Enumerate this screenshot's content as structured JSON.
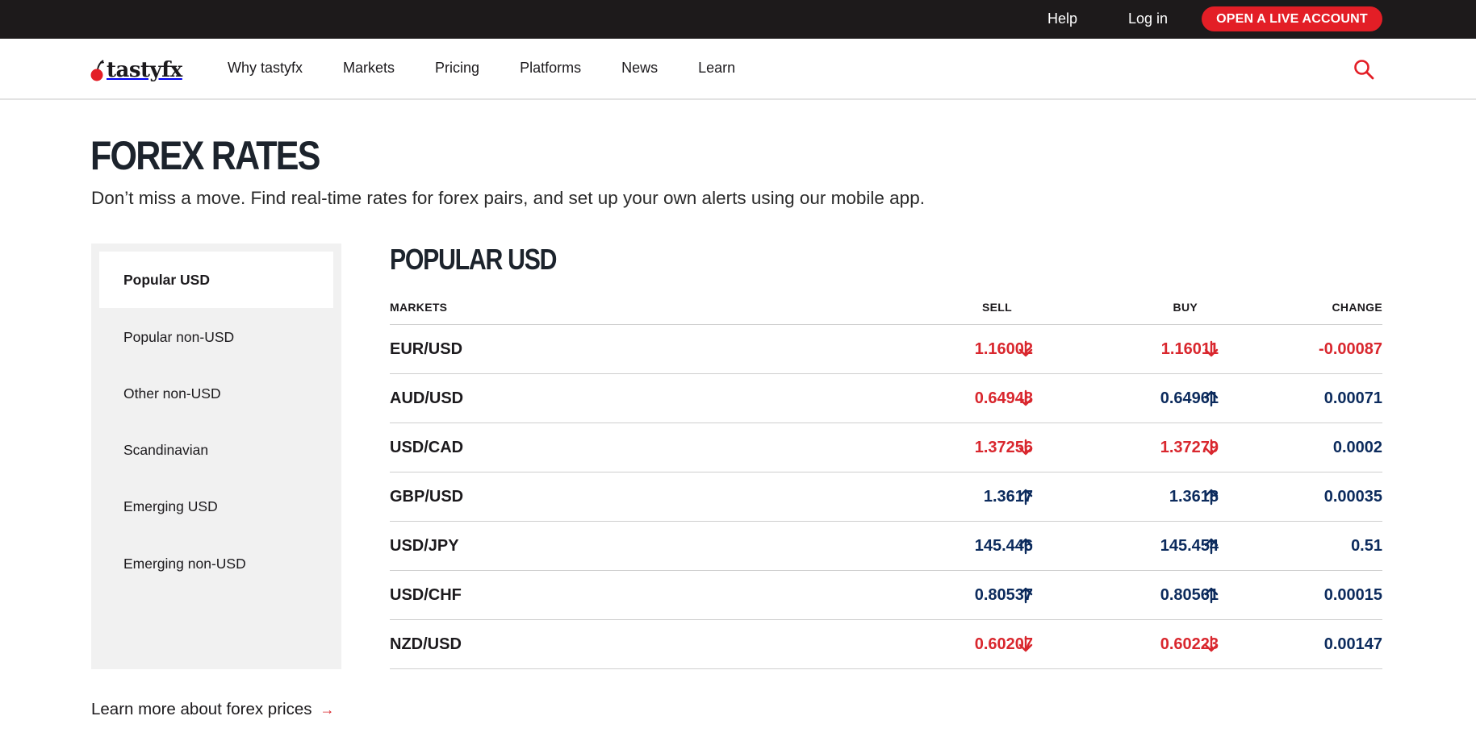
{
  "colors": {
    "accent_red": "#e31e26",
    "down": "#d9272e",
    "up": "#0c2b5d",
    "topbar_bg": "#1d1a1b",
    "sidebar_bg": "#f1f1f1"
  },
  "topbar": {
    "help": "Help",
    "login": "Log in",
    "cta": "OPEN A LIVE ACCOUNT"
  },
  "nav": {
    "logo": "tastyfx",
    "links": [
      "Why tastyfx",
      "Markets",
      "Pricing",
      "Platforms",
      "News",
      "Learn"
    ],
    "search_icon": "search-icon"
  },
  "page": {
    "title": "FOREX RATES",
    "subtitle": "Don’t miss a move. Find real-time rates for forex pairs, and set up your own alerts using our mobile app."
  },
  "sidebar": {
    "items": [
      {
        "label": "Popular USD",
        "active": true
      },
      {
        "label": "Popular non-USD",
        "active": false
      },
      {
        "label": "Other non-USD",
        "active": false
      },
      {
        "label": "Scandinavian",
        "active": false
      },
      {
        "label": "Emerging USD",
        "active": false
      },
      {
        "label": "Emerging non-USD",
        "active": false
      }
    ]
  },
  "table": {
    "title": "POPULAR USD",
    "headers": {
      "market": "MARKETS",
      "sell": "SELL",
      "buy": "BUY",
      "change": "CHANGE"
    },
    "rows": [
      {
        "market": "EUR/USD",
        "sell": "1.16002",
        "sell_dir": "down",
        "buy": "1.16011",
        "buy_dir": "down",
        "change": "-0.00087",
        "change_dir": "down"
      },
      {
        "market": "AUD/USD",
        "sell": "0.64948",
        "sell_dir": "down",
        "buy": "0.64961",
        "buy_dir": "up",
        "change": "0.00071",
        "change_dir": "up"
      },
      {
        "market": "USD/CAD",
        "sell": "1.37256",
        "sell_dir": "down",
        "buy": "1.37279",
        "buy_dir": "down",
        "change": "0.0002",
        "change_dir": "up"
      },
      {
        "market": "GBP/USD",
        "sell": "1.3617",
        "sell_dir": "up",
        "buy": "1.3618",
        "buy_dir": "up",
        "change": "0.00035",
        "change_dir": "up"
      },
      {
        "market": "USD/JPY",
        "sell": "145.446",
        "sell_dir": "up",
        "buy": "145.454",
        "buy_dir": "up",
        "change": "0.51",
        "change_dir": "up"
      },
      {
        "market": "USD/CHF",
        "sell": "0.80537",
        "sell_dir": "up",
        "buy": "0.80561",
        "buy_dir": "up",
        "change": "0.00015",
        "change_dir": "up"
      },
      {
        "market": "NZD/USD",
        "sell": "0.60207",
        "sell_dir": "down",
        "buy": "0.60223",
        "buy_dir": "down",
        "change": "0.00147",
        "change_dir": "up"
      }
    ]
  },
  "footer_link": {
    "label": "Learn more about forex prices",
    "arrow": "→"
  }
}
